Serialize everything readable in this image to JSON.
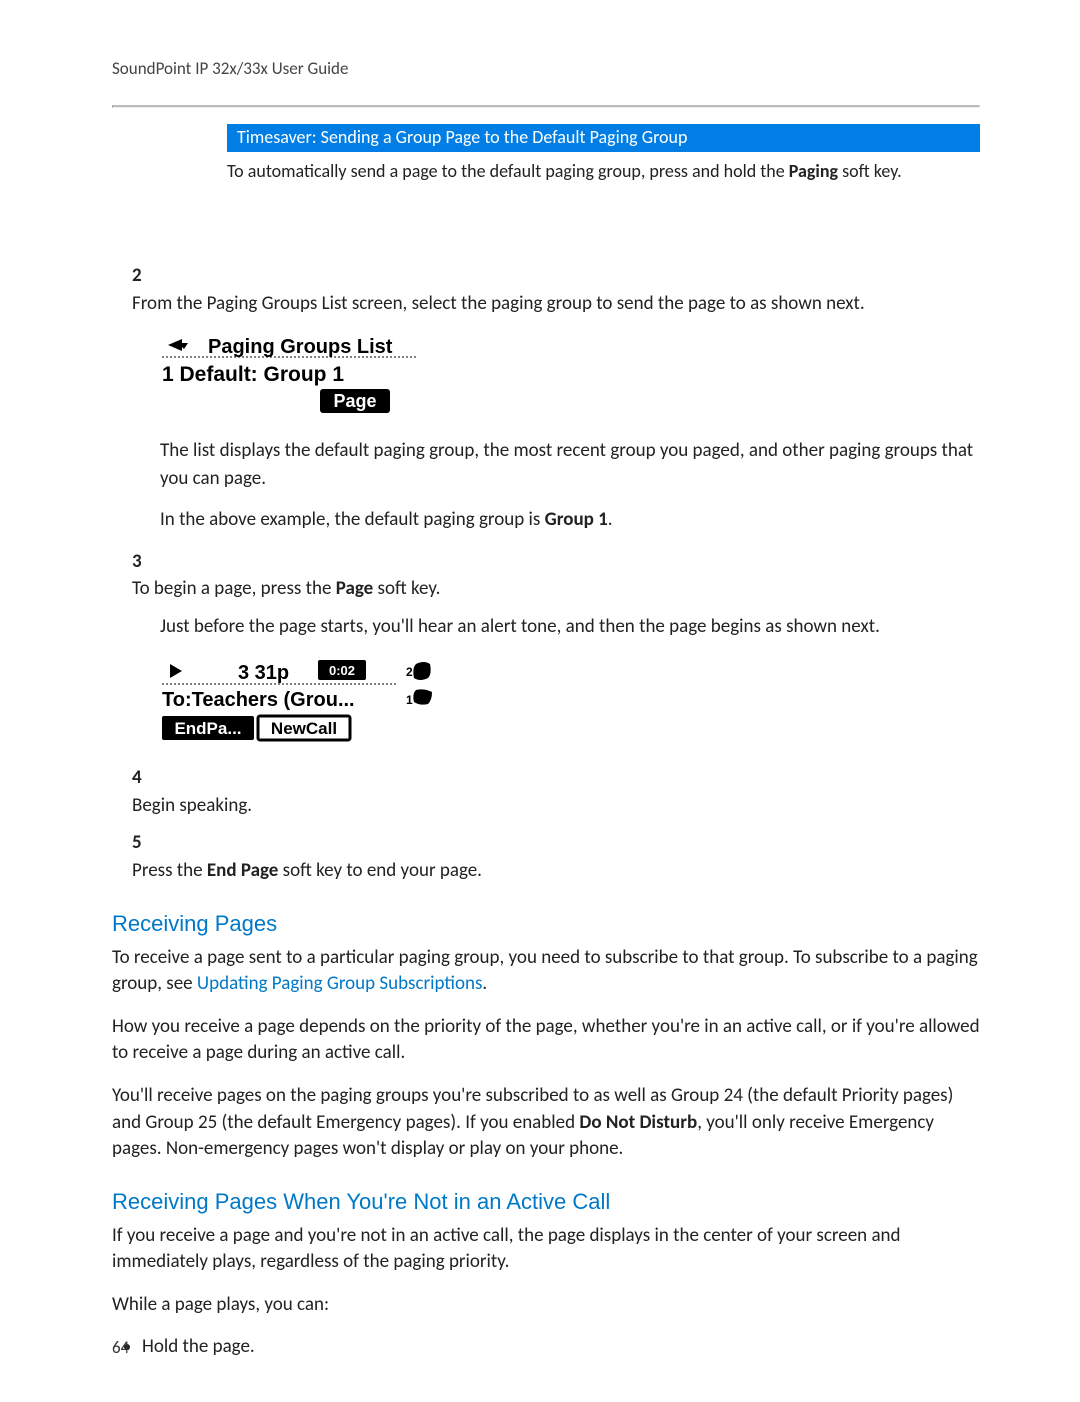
{
  "running_head": "SoundPoint IP 32x/33x User Guide",
  "timesaver": {
    "title": "Timesaver: Sending a Group Page to the Default Paging Group",
    "body_pre": "To automatically send a page to the default paging group, press and hold the ",
    "body_bold": "Paging",
    "body_post": " soft key."
  },
  "steps": {
    "s2_num": "2",
    "s2_text": "From the Paging Groups List screen, select the paging group to send the page to as shown next.",
    "fig1": {
      "title": "Paging Groups List",
      "line1": "1 Default: Group 1",
      "softkey": "Page"
    },
    "s2_cont1": "The list displays the default paging group, the most recent group you paged, and other paging groups that you can page.",
    "s2_cont2_pre": "In the above example, the default paging group is ",
    "s2_cont2_bold": "Group 1",
    "s2_cont2_post": ".",
    "s3_num": "3",
    "s3_pre": "To begin a page, press the ",
    "s3_bold": "Page",
    "s3_post": " soft key.",
    "s3_cont": "Just before the page starts, you'll hear an alert tone, and then the page begins as shown next.",
    "fig2": {
      "time": "3 31p",
      "timer": "0:02",
      "line2": "To:Teachers (Grou...",
      "sk_left": "EndPa...",
      "sk_right": "NewCall",
      "badge1": "2",
      "badge2": "1"
    },
    "s4_num": "4",
    "s4_text": "Begin speaking.",
    "s5_num": "5",
    "s5_pre": "Press the ",
    "s5_bold": "End Page",
    "s5_post": " soft key to end your page."
  },
  "sections": {
    "recv_h": "Receiving Pages",
    "recv_p1_pre": "To receive a page sent to a particular paging group, you need to subscribe to that group. To subscribe to a paging group, see ",
    "recv_p1_link": "Updating Paging Group Subscriptions",
    "recv_p1_post": ".",
    "recv_p2": "How you receive a page depends on the priority of the page, whether you're in an active call, or if you're allowed to receive a page during an active call.",
    "recv_p3_pre": "You'll receive pages on the paging groups you're subscribed to as well as Group 24 (the default Priority pages) and Group 25 (the default Emergency pages). If you enabled ",
    "recv_p3_bold": "Do Not Disturb",
    "recv_p3_post": ", you'll only receive Emergency pages. Non-emergency pages won't display or play on your phone.",
    "recv_nac_h": "Receiving Pages When You're Not in an Active Call",
    "recv_nac_p1": "If you receive a page and you're not in an active call, the page displays in the center of your screen and immediately plays, regardless of the paging priority.",
    "recv_nac_p2": "While a page plays, you can:",
    "bullet1": "Hold the page."
  },
  "page_number": "64"
}
